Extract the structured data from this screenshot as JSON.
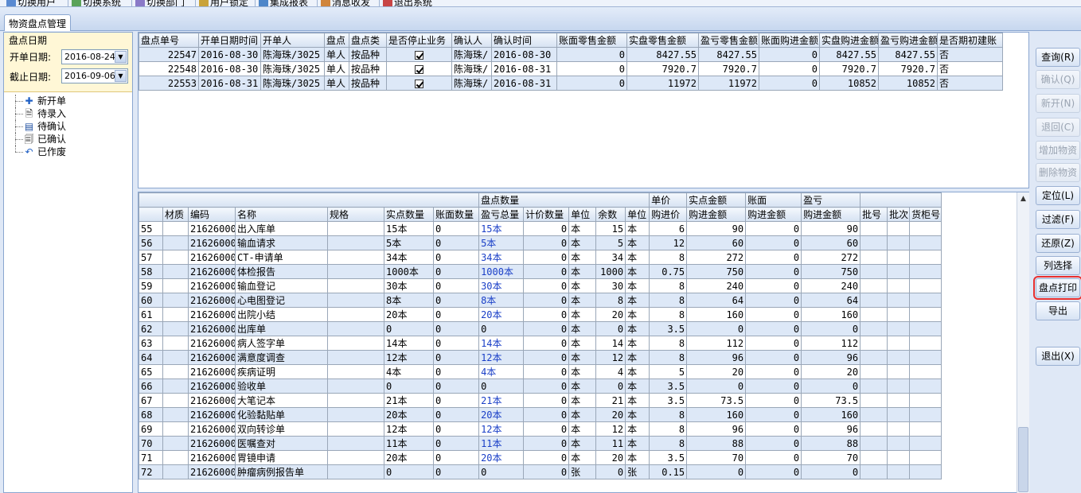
{
  "toolbar": {
    "items": [
      {
        "label": "切换用户",
        "icon": "switch-user-icon"
      },
      {
        "label": "切换系统",
        "icon": "switch-system-icon"
      },
      {
        "label": "切换部门",
        "icon": "switch-department-icon"
      },
      {
        "label": "用户锁定",
        "icon": "user-lock-icon"
      },
      {
        "label": "集成报表",
        "icon": "report-icon"
      },
      {
        "label": "消息收发",
        "icon": "message-icon"
      },
      {
        "label": "退出系统",
        "icon": "exit-icon"
      }
    ]
  },
  "tab": {
    "label": "物资盘点管理"
  },
  "date_panel": {
    "caption": "盘点日期",
    "start_label": "开单日期:",
    "start_value": "2016-08-24",
    "end_label": "截止日期:",
    "end_value": "2016-09-06"
  },
  "tree": {
    "items": [
      {
        "label": "新开单",
        "icon": "plus-icon"
      },
      {
        "label": "待录入",
        "icon": "document-edit-icon"
      },
      {
        "label": "待确认",
        "icon": "list-icon"
      },
      {
        "label": "已确认",
        "icon": "confirmed-doc-icon"
      },
      {
        "label": "已作废",
        "icon": "undo-icon"
      }
    ]
  },
  "top_table": {
    "headers": [
      "盘点单号",
      "开单日期时间",
      "开单人",
      "盘点",
      "盘点类",
      "是否停止业务",
      "确认人",
      "确认时间",
      "账面零售金额",
      "实盘零售金额",
      "盈亏零售金额",
      "账面购进金额",
      "实盘购进金额",
      "盈亏购进金额",
      "是否期初建账"
    ],
    "rows": [
      {
        "id": "22547",
        "date": "2016-08-30",
        "creator": "陈海珠/3025",
        "scope": "单人",
        "type": "按品种",
        "stopped": true,
        "confirmer": "陈海珠/",
        "confirm_time": "2016-08-30",
        "book_retail": "0",
        "actual_retail": "8427.55",
        "diff_retail": "8427.55",
        "book_purchase": "0",
        "actual_purchase": "8427.55",
        "diff_purchase": "8427.55",
        "initial": "否"
      },
      {
        "id": "22548",
        "date": "2016-08-30",
        "creator": "陈海珠/3025",
        "scope": "单人",
        "type": "按品种",
        "stopped": true,
        "confirmer": "陈海珠/",
        "confirm_time": "2016-08-31",
        "book_retail": "0",
        "actual_retail": "7920.7",
        "diff_retail": "7920.7",
        "book_purchase": "0",
        "actual_purchase": "7920.7",
        "diff_purchase": "7920.7",
        "initial": "否"
      },
      {
        "id": "22553",
        "date": "2016-08-31",
        "creator": "陈海珠/3025",
        "scope": "单人",
        "type": "按品种",
        "stopped": true,
        "confirmer": "陈海珠/",
        "confirm_time": "2016-08-31",
        "book_retail": "0",
        "actual_retail": "11972",
        "diff_retail": "11972",
        "book_purchase": "0",
        "actual_purchase": "10852",
        "diff_purchase": "10852",
        "initial": "否"
      }
    ]
  },
  "bottom_table": {
    "group_headers": {
      "count": "盘点数量",
      "unit_price": "单价",
      "actual_amount": "实点金额",
      "book": "账面",
      "diff": "盈亏"
    },
    "headers": [
      "材质",
      "编码",
      "名称",
      "规格",
      "实点数量",
      "账面数量",
      "盈亏总量",
      "计价数量",
      "单位",
      "余数",
      "单位",
      "购进价",
      "购进金额",
      "购进金额",
      "购进金额",
      "批号",
      "批次",
      "货柜号"
    ],
    "rows": [
      {
        "n": "55",
        "code": "21626000",
        "name": "出入库单",
        "qty": "15本",
        "book": "0",
        "diff": "15本",
        "pq": "0",
        "unit": "本",
        "rem": "15",
        "unit2": "本",
        "price": "6",
        "amount": "90",
        "book_amt": "0",
        "diff_amt": "90"
      },
      {
        "n": "56",
        "code": "21626000",
        "name": "输血请求",
        "qty": "5本",
        "book": "0",
        "diff": "5本",
        "pq": "0",
        "unit": "本",
        "rem": "5",
        "unit2": "本",
        "price": "12",
        "amount": "60",
        "book_amt": "0",
        "diff_amt": "60"
      },
      {
        "n": "57",
        "code": "21626000",
        "name": "CT-申请单",
        "qty": "34本",
        "book": "0",
        "diff": "34本",
        "pq": "0",
        "unit": "本",
        "rem": "34",
        "unit2": "本",
        "price": "8",
        "amount": "272",
        "book_amt": "0",
        "diff_amt": "272"
      },
      {
        "n": "58",
        "code": "21626000",
        "name": "体检报告",
        "qty": "1000本",
        "book": "0",
        "diff": "1000本",
        "pq": "0",
        "unit": "本",
        "rem": "1000",
        "unit2": "本",
        "price": "0.75",
        "amount": "750",
        "book_amt": "0",
        "diff_amt": "750"
      },
      {
        "n": "59",
        "code": "21626000",
        "name": "输血登记",
        "qty": "30本",
        "book": "0",
        "diff": "30本",
        "pq": "0",
        "unit": "本",
        "rem": "30",
        "unit2": "本",
        "price": "8",
        "amount": "240",
        "book_amt": "0",
        "diff_amt": "240"
      },
      {
        "n": "60",
        "code": "21626000",
        "name": "心电图登记",
        "qty": "8本",
        "book": "0",
        "diff": "8本",
        "pq": "0",
        "unit": "本",
        "rem": "8",
        "unit2": "本",
        "price": "8",
        "amount": "64",
        "book_amt": "0",
        "diff_amt": "64"
      },
      {
        "n": "61",
        "code": "21626000",
        "name": "出院小结",
        "qty": "20本",
        "book": "0",
        "diff": "20本",
        "pq": "0",
        "unit": "本",
        "rem": "20",
        "unit2": "本",
        "price": "8",
        "amount": "160",
        "book_amt": "0",
        "diff_amt": "160"
      },
      {
        "n": "62",
        "code": "21626000",
        "name": "出库单",
        "qty": "0",
        "book": "0",
        "diff": "0",
        "pq": "0",
        "unit": "本",
        "rem": "0",
        "unit2": "本",
        "price": "3.5",
        "amount": "0",
        "book_amt": "0",
        "diff_amt": "0"
      },
      {
        "n": "63",
        "code": "21626000",
        "name": "病人签字单",
        "qty": "14本",
        "book": "0",
        "diff": "14本",
        "pq": "0",
        "unit": "本",
        "rem": "14",
        "unit2": "本",
        "price": "8",
        "amount": "112",
        "book_amt": "0",
        "diff_amt": "112"
      },
      {
        "n": "64",
        "code": "21626000",
        "name": "满意度调查",
        "qty": "12本",
        "book": "0",
        "diff": "12本",
        "pq": "0",
        "unit": "本",
        "rem": "12",
        "unit2": "本",
        "price": "8",
        "amount": "96",
        "book_amt": "0",
        "diff_amt": "96"
      },
      {
        "n": "65",
        "code": "21626000",
        "name": "疾病证明",
        "qty": "4本",
        "book": "0",
        "diff": "4本",
        "pq": "0",
        "unit": "本",
        "rem": "4",
        "unit2": "本",
        "price": "5",
        "amount": "20",
        "book_amt": "0",
        "diff_amt": "20"
      },
      {
        "n": "66",
        "code": "21626000",
        "name": "验收单",
        "qty": "0",
        "book": "0",
        "diff": "0",
        "pq": "0",
        "unit": "本",
        "rem": "0",
        "unit2": "本",
        "price": "3.5",
        "amount": "0",
        "book_amt": "0",
        "diff_amt": "0"
      },
      {
        "n": "67",
        "code": "21626000",
        "name": "大笔记本",
        "qty": "21本",
        "book": "0",
        "diff": "21本",
        "pq": "0",
        "unit": "本",
        "rem": "21",
        "unit2": "本",
        "price": "3.5",
        "amount": "73.5",
        "book_amt": "0",
        "diff_amt": "73.5"
      },
      {
        "n": "68",
        "code": "21626000",
        "name": "化验黏贴单",
        "qty": "20本",
        "book": "0",
        "diff": "20本",
        "pq": "0",
        "unit": "本",
        "rem": "20",
        "unit2": "本",
        "price": "8",
        "amount": "160",
        "book_amt": "0",
        "diff_amt": "160"
      },
      {
        "n": "69",
        "code": "21626000",
        "name": "双向转诊单",
        "qty": "12本",
        "book": "0",
        "diff": "12本",
        "pq": "0",
        "unit": "本",
        "rem": "12",
        "unit2": "本",
        "price": "8",
        "amount": "96",
        "book_amt": "0",
        "diff_amt": "96"
      },
      {
        "n": "70",
        "code": "21626000",
        "name": "医嘱查对",
        "qty": "11本",
        "book": "0",
        "diff": "11本",
        "pq": "0",
        "unit": "本",
        "rem": "11",
        "unit2": "本",
        "price": "8",
        "amount": "88",
        "book_amt": "0",
        "diff_amt": "88"
      },
      {
        "n": "71",
        "code": "21626000",
        "name": "胃镜申请",
        "qty": "20本",
        "book": "0",
        "diff": "20本",
        "pq": "0",
        "unit": "本",
        "rem": "20",
        "unit2": "本",
        "price": "3.5",
        "amount": "70",
        "book_amt": "0",
        "diff_amt": "70"
      },
      {
        "n": "72",
        "code": "21626000",
        "name": "肿瘤病例报告单",
        "qty": "0",
        "book": "0",
        "diff": "0",
        "pq": "0",
        "unit": "张",
        "rem": "0",
        "unit2": "张",
        "price": "0.15",
        "amount": "0",
        "book_amt": "0",
        "diff_amt": "0"
      }
    ]
  },
  "right_buttons": [
    {
      "label": "查询(R)",
      "enabled": true
    },
    {
      "label": "确认(Q)",
      "enabled": false
    },
    {
      "label": "新开(N)",
      "enabled": false
    },
    {
      "label": "退回(C)",
      "enabled": false
    },
    {
      "label": "增加物资",
      "enabled": false
    },
    {
      "label": "删除物资",
      "enabled": false
    },
    {
      "label": "定位(L)",
      "enabled": true
    },
    {
      "label": "过滤(F)",
      "enabled": true
    },
    {
      "label": "还原(Z)",
      "enabled": true
    },
    {
      "label": "列选择",
      "enabled": true
    },
    {
      "label": "盘点打印",
      "enabled": true,
      "highlighted": true
    },
    {
      "label": "导出",
      "enabled": true
    },
    {
      "label": "退出(X)",
      "enabled": true
    }
  ],
  "colors": {
    "highlight_border": "#e83030",
    "link_blue": "#1a3fc7",
    "alt_row": "#dde8f7"
  }
}
